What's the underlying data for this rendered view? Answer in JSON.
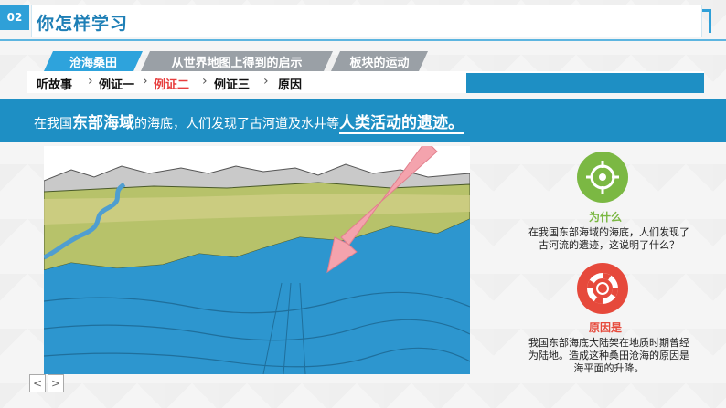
{
  "header": {
    "number": "02",
    "title": "你怎样学习"
  },
  "tabs": [
    "沧海桑田",
    "从世界地图上得到的启示",
    "板块的运动"
  ],
  "steps": [
    "听故事",
    "例证一",
    "例证二",
    "例证三",
    "原因"
  ],
  "statement": {
    "part1": "在我国",
    "bold1": "东部海域",
    "part2": "的海底，人们发现了古河道及水井等",
    "bold2": "人类活动的遗迹。"
  },
  "why": {
    "icon": "target-icon",
    "title": "为什么",
    "text_lines": [
      "在我国东部海域的海底，人们发现了",
      "古河流的遗迹，这说明了什么？"
    ]
  },
  "reason": {
    "icon": "lifebuoy-icon",
    "title": "原因是",
    "text_lines": [
      "我国东部海底大陆架在地质时期曾经",
      "为陆地。造成这种桑田沧海的原因是",
      "海平面的升降。"
    ]
  },
  "nav": {
    "prev": "<",
    "next": ">"
  },
  "colors": {
    "accent": "#1e8fc4",
    "active_step": "#e73d3d",
    "why_green": "#7bb843",
    "reason_red": "#e6493b"
  }
}
